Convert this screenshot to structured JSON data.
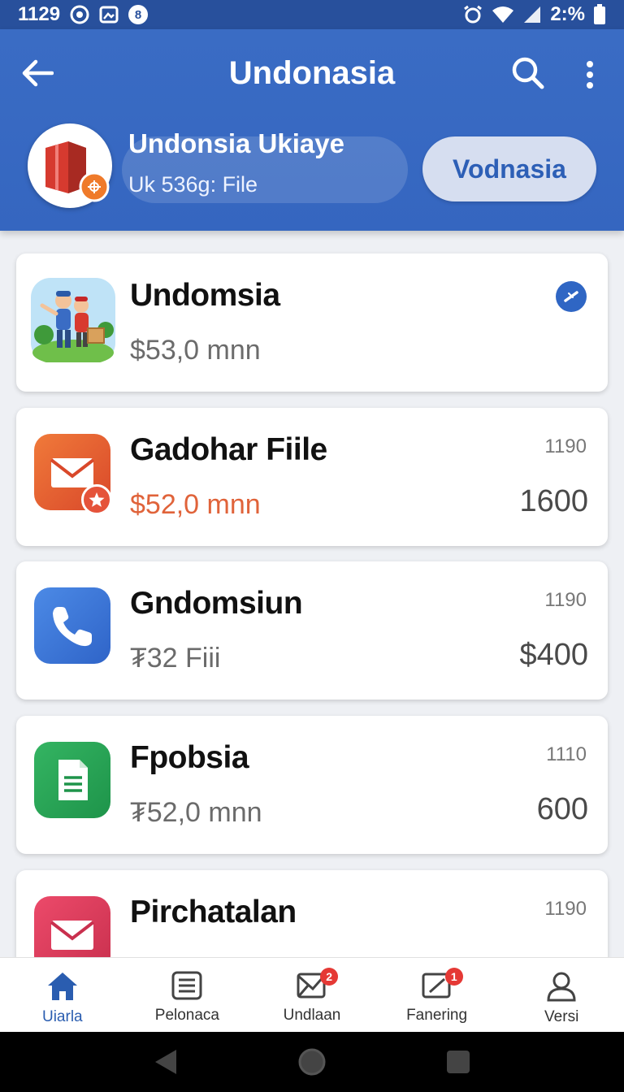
{
  "status_bar": {
    "time": "1129",
    "notification_count": "8",
    "battery": "2:%"
  },
  "header": {
    "title": "Undonasia",
    "profile_name": "Undonsia Ukiaye",
    "profile_sub": "Uk 536g: File",
    "action_label": "Vodnasia"
  },
  "items": [
    {
      "title": "Undomsia",
      "subtitle": "$53,0 mnn",
      "meta": "",
      "amount": ""
    },
    {
      "title": "Gadohar Fiile",
      "subtitle": "$52,0 mnn",
      "meta": "1190",
      "amount": "1600"
    },
    {
      "title": "Gndomsiun",
      "subtitle": "₮32 Fiii",
      "meta": "1190",
      "amount": "$400"
    },
    {
      "title": "Fpobsia",
      "subtitle": "₮52,0 mnn",
      "meta": "1110",
      "amount": "600"
    },
    {
      "title": "Pirchatalan",
      "subtitle": "",
      "meta": "1190",
      "amount": ""
    }
  ],
  "bottom_nav": [
    {
      "label": "Uiarla",
      "icon": "home-icon",
      "badge": ""
    },
    {
      "label": "Pelonaca",
      "icon": "list-icon",
      "badge": ""
    },
    {
      "label": "Undlaan",
      "icon": "mail-icon",
      "badge": "2"
    },
    {
      "label": "Fanering",
      "icon": "edit-icon",
      "badge": "1"
    },
    {
      "label": "Versi",
      "icon": "person-icon",
      "badge": ""
    }
  ],
  "colors": {
    "header": "#3a6cc4",
    "status_bar": "#28509c",
    "accent_orange": "#e0633a",
    "active_nav": "#2a5db0"
  }
}
